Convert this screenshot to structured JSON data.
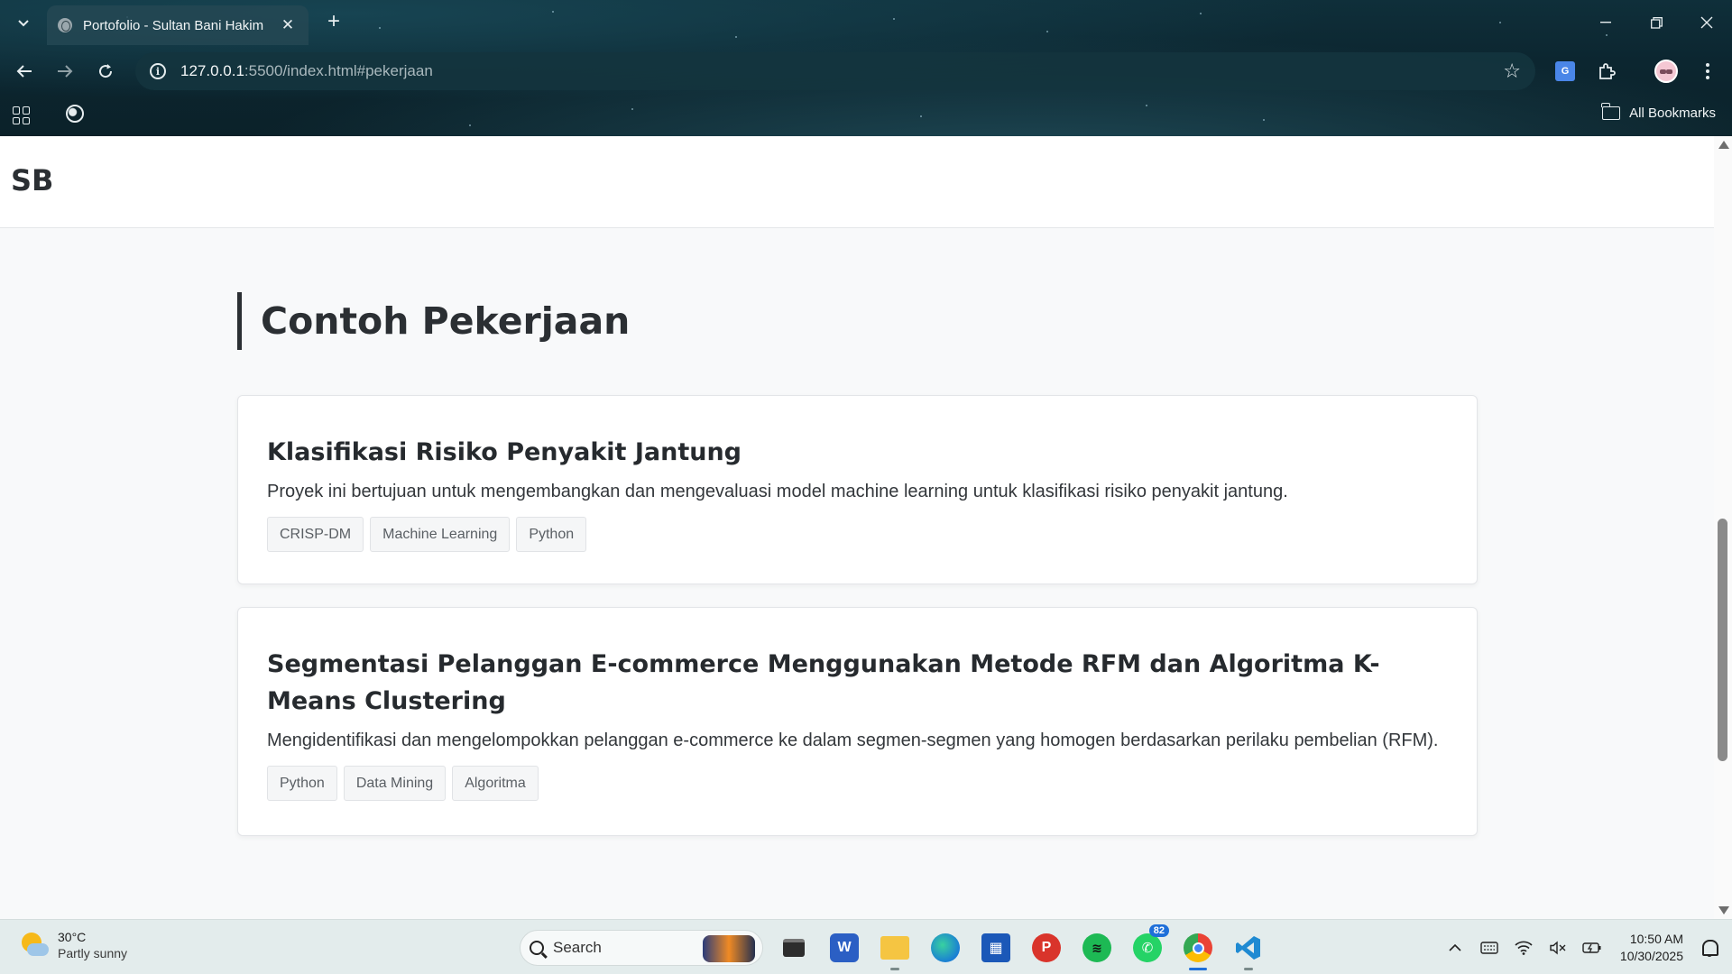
{
  "browser": {
    "tab_title": "Portofolio - Sultan Bani Hakim",
    "url_host": "127.0.0.1",
    "url_rest": ":5500/index.html#pekerjaan",
    "all_bookmarks_label": "All Bookmarks"
  },
  "site": {
    "logo": "SB",
    "section_title": "Contoh Pekerjaan",
    "projects": [
      {
        "title": "Klasifikasi Risiko Penyakit Jantung",
        "description": "Proyek ini bertujuan untuk mengembangkan dan mengevaluasi model machine learning untuk klasifikasi risiko penyakit jantung.",
        "tags": [
          "CRISP-DM",
          "Machine Learning",
          "Python"
        ]
      },
      {
        "title": "Segmentasi Pelanggan E-commerce Menggunakan Metode RFM dan Algoritma K-Means Clustering",
        "description": "Mengidentifikasi dan mengelompokkan pelanggan e-commerce ke dalam segmen-segmen yang homogen berdasarkan perilaku pembelian (RFM).",
        "tags": [
          "Python",
          "Data Mining",
          "Algoritma"
        ]
      }
    ]
  },
  "taskbar": {
    "weather_temp": "30°C",
    "weather_condition": "Partly sunny",
    "search_label": "Search",
    "whatsapp_badge": "82",
    "time": "10:50 AM",
    "date": "10/30/2025",
    "apps": [
      "task-view",
      "word",
      "file-explorer",
      "edge",
      "microsoft-store",
      "pdf-reader",
      "spotify",
      "whatsapp",
      "chrome",
      "vscode"
    ]
  },
  "colors": {
    "accent": "#1e6fd9",
    "heading": "#2b2f33",
    "page_bg": "#f8f9fa"
  }
}
